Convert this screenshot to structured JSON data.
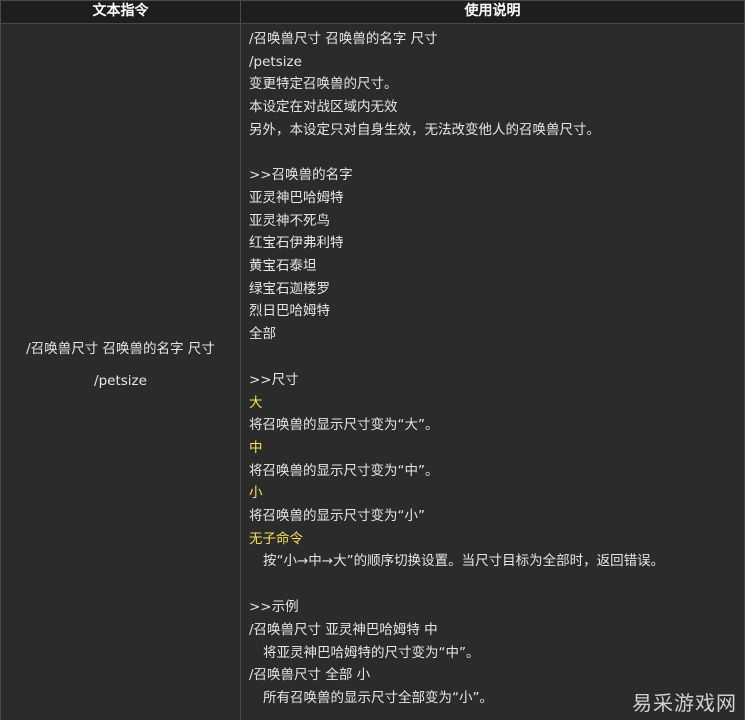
{
  "header": {
    "col_command": "文本指令",
    "col_usage": "使用说明"
  },
  "command": {
    "line1": "/召唤兽尺寸 召唤兽的名字 尺寸",
    "line2": "/petsize"
  },
  "usage": {
    "lines": [
      "/召唤兽尺寸 召唤兽的名字 尺寸",
      "/petsize",
      "变更特定召唤兽的尺寸。",
      "本设定在对战区域内无效",
      "另外，本设定只对自身生效，无法改变他人的召唤兽尺寸。",
      ">>召唤兽的名字",
      "亚灵神巴哈姆特",
      "亚灵神不死鸟",
      "红宝石伊弗利特",
      "黄宝石泰坦",
      "绿宝石迦楼罗",
      "烈日巴哈姆特",
      "全部",
      ">>尺寸",
      "大",
      "将召唤兽的显示尺寸变为“大”。",
      "中",
      "将召唤兽的显示尺寸变为“中”。",
      "小",
      "将召唤兽的显示尺寸变为“小”",
      "无子命令",
      "按“小→中→大”的顺序切换设置。当尺寸目标为全部时，返回错误。",
      ">>示例",
      "/召唤兽尺寸 亚灵神巴哈姆特 中",
      "将亚灵神巴哈姆特的尺寸变为“中”。",
      "/召唤兽尺寸 全部 小",
      "所有召唤兽的显示尺寸全部变为“小”。"
    ]
  },
  "watermark": "易采游戏网",
  "colors": {
    "background": "#2b2b2b",
    "header_bg": "#1e1e1e",
    "text": "#e6e6e6",
    "highlight": "#f3e15a",
    "border": "#4a4a4a"
  }
}
